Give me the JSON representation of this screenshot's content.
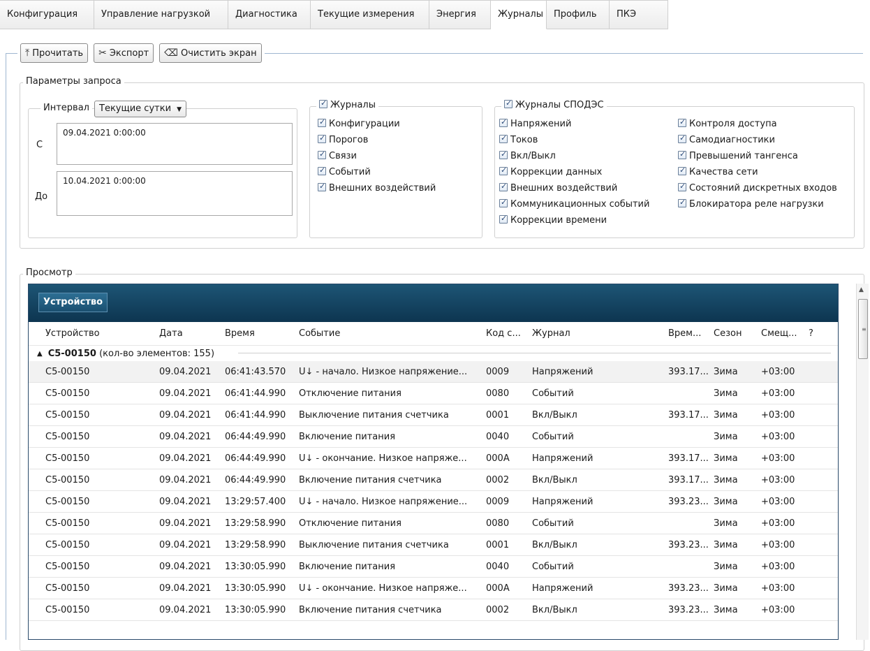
{
  "tabs": [
    "Конфигурация",
    "Управление нагрузкой",
    "Диагностика",
    "Текущие измерения",
    "Энергия",
    "Журналы",
    "Профиль",
    "ПКЭ"
  ],
  "active_tab": "Журналы",
  "toolbar": {
    "read_label": "Прочитать",
    "export_label": "Экспорт",
    "clear_label": "Очистить экран"
  },
  "query": {
    "title": "Параметры запроса",
    "interval_label": "Интервал",
    "interval_value": "Текущие сутки",
    "from_label": "С",
    "from_value": "09.04.2021 0:00:00",
    "to_label": "До",
    "to_value": "10.04.2021 0:00:00"
  },
  "journals": {
    "title": "Журналы",
    "items": [
      "Конфигурации",
      "Порогов",
      "Связи",
      "Событий",
      "Внешних воздействий"
    ]
  },
  "spodes": {
    "title": "Журналы СПОДЭС",
    "col1": [
      "Напряжений",
      "Токов",
      "Вкл/Выкл",
      "Коррекции данных",
      "Внешних воздействий",
      "Коммуникационных событий",
      "Коррекции времени"
    ],
    "col2": [
      "Контроля доступа",
      "Самодиагностики",
      "Превышений тангенса",
      "Качества сети",
      "Состояний дискретных входов",
      "Блокиратора реле нагрузки"
    ]
  },
  "view": {
    "title": "Просмотр",
    "group_chip": "Устройство",
    "columns": [
      "Устройство",
      "Дата",
      "Время",
      "Событие",
      "Код с...",
      "Журнал",
      "Врем...",
      "Сезон",
      "Смещ...",
      "?"
    ],
    "group_name": "C5-00150",
    "group_count": "(кол-во элементов: 155)",
    "rows": [
      [
        "C5-00150",
        "09.04.2021",
        "06:41:43.570",
        "U↓ - начало. Низкое напряжение...",
        "0009",
        "Напряжений",
        "393.17...",
        "Зима",
        "+03:00"
      ],
      [
        "C5-00150",
        "09.04.2021",
        "06:41:44.990",
        "Отключение питания",
        "0080",
        "Событий",
        "",
        "Зима",
        "+03:00"
      ],
      [
        "C5-00150",
        "09.04.2021",
        "06:41:44.990",
        "Выключение питания счетчика",
        "0001",
        "Вкл/Выкл",
        "393.17...",
        "Зима",
        "+03:00"
      ],
      [
        "C5-00150",
        "09.04.2021",
        "06:44:49.990",
        "Включение питания",
        "0040",
        "Событий",
        "",
        "Зима",
        "+03:00"
      ],
      [
        "C5-00150",
        "09.04.2021",
        "06:44:49.990",
        "U↓ - окончание. Низкое напряже...",
        "000A",
        "Напряжений",
        "393.17...",
        "Зима",
        "+03:00"
      ],
      [
        "C5-00150",
        "09.04.2021",
        "06:44:49.990",
        "Включение питания счетчика",
        "0002",
        "Вкл/Выкл",
        "393.17...",
        "Зима",
        "+03:00"
      ],
      [
        "C5-00150",
        "09.04.2021",
        "13:29:57.400",
        "U↓ - начало. Низкое напряжение...",
        "0009",
        "Напряжений",
        "393.23...",
        "Зима",
        "+03:00"
      ],
      [
        "C5-00150",
        "09.04.2021",
        "13:29:58.990",
        "Отключение питания",
        "0080",
        "Событий",
        "",
        "Зима",
        "+03:00"
      ],
      [
        "C5-00150",
        "09.04.2021",
        "13:29:58.990",
        "Выключение питания счетчика",
        "0001",
        "Вкл/Выкл",
        "393.23...",
        "Зима",
        "+03:00"
      ],
      [
        "C5-00150",
        "09.04.2021",
        "13:30:05.990",
        "Включение питания",
        "0040",
        "Событий",
        "",
        "Зима",
        "+03:00"
      ],
      [
        "C5-00150",
        "09.04.2021",
        "13:30:05.990",
        "U↓ - окончание. Низкое напряже...",
        "000A",
        "Напряжений",
        "393.23...",
        "Зима",
        "+03:00"
      ],
      [
        "C5-00150",
        "09.04.2021",
        "13:30:05.990",
        "Включение питания счетчика",
        "0002",
        "Вкл/Выкл",
        "393.23...",
        "Зима",
        "+03:00"
      ]
    ]
  }
}
